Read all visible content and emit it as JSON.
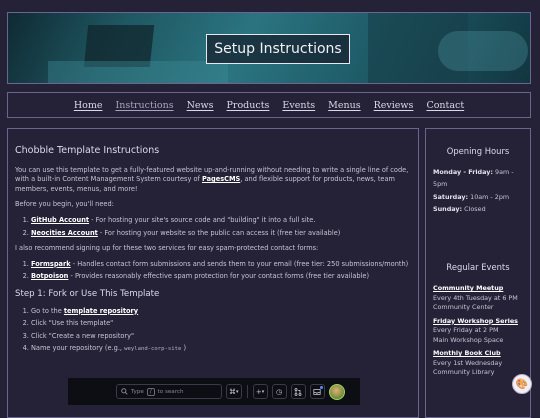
{
  "hero": {
    "title": "Setup Instructions"
  },
  "nav": {
    "items": [
      {
        "label": "Home"
      },
      {
        "label": "Instructions"
      },
      {
        "label": "News"
      },
      {
        "label": "Products"
      },
      {
        "label": "Events"
      },
      {
        "label": "Menus"
      },
      {
        "label": "Reviews"
      },
      {
        "label": "Contact"
      }
    ],
    "active": "Instructions"
  },
  "main": {
    "title": "Chobble Template Instructions",
    "intro_pre": "You can use this template to get a fully-featured website up-and-running without needing to write a single line of code, with a built-in Content Management System courtesy of ",
    "intro_link": "PagesCMS",
    "intro_post": ", and flexible support for products, news, team members, events, menus, and more!",
    "before": "Before you begin, you'll need:",
    "needs": [
      {
        "link": "GitHub Account",
        "text": " - For hosting your site's source code and \"building\" it into a full site."
      },
      {
        "link": "Neocities Account",
        "text": " - For hosting your website so the public can access it (free tier available)"
      }
    ],
    "recommend": "I also recommend signing up for these two services for easy spam-protected contact forms:",
    "services": [
      {
        "link": "Formspark",
        "text": " - Handles contact form submissions and sends them to your email (free tier: 250 submissions/month)"
      },
      {
        "link": "Botpoison",
        "text": " - Provides reasonably effective spam protection for your contact forms (free tier available)"
      }
    ],
    "step1_title": "Step 1: Fork or Use This Template",
    "steps": {
      "s1_pre": "Go to the ",
      "s1_link": "template repository",
      "s2": "Click \"Use this template\"",
      "s3": "Click \"Create a new repository\"",
      "s4_pre": "Name your repository (e.g., ",
      "s4_code": "weyland-corp-site",
      "s4_post": " )"
    }
  },
  "sidebar": {
    "hours_title": "Opening Hours",
    "hours": [
      {
        "day": "Monday - Friday:",
        "time": " 9am - 5pm"
      },
      {
        "day": "Saturday:",
        "time": " 10am - 2pm"
      },
      {
        "day": "Sunday:",
        "time": " Closed"
      }
    ],
    "events_title": "Regular Events",
    "events": [
      {
        "name": "Community Meetup",
        "when": "Every 4th Tuesday at 6 PM",
        "where": "Community Center"
      },
      {
        "name": "Friday Workshop Series",
        "when": "Every Friday at 2 PM",
        "where": "Main Workshop Space"
      },
      {
        "name": "Monthly Book Club",
        "when": "Every 1st Wednesday",
        "where": "Community Library"
      }
    ]
  },
  "toolbar": {
    "search_placeholder_pre": "Type",
    "search_key": "/",
    "search_placeholder_post": "to search",
    "icons": [
      "cmd-icon",
      "plus-icon",
      "clock-icon",
      "pull-request-icon",
      "inbox-icon",
      "avatar"
    ]
  },
  "floating": {
    "icon": "palette-icon"
  }
}
